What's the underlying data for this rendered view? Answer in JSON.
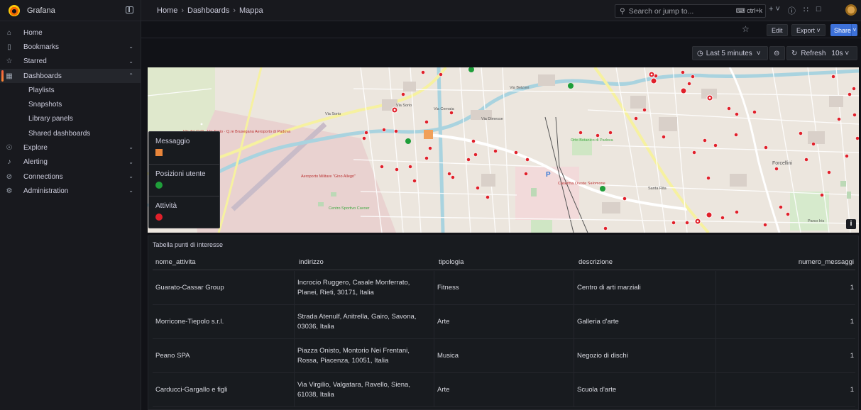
{
  "app": {
    "title": "Grafana"
  },
  "breadcrumb": {
    "home": "Home",
    "dashboards": "Dashboards",
    "current": "Mappa",
    "sep": "›"
  },
  "search": {
    "placeholder": "Search or jump to...",
    "shortcut": "ctrl+k"
  },
  "toolbar": {
    "edit_label": "Edit",
    "export_label": "Export",
    "share_label": "Share"
  },
  "controls": {
    "time_range": "Last 5 minutes",
    "refresh_label": "Refresh",
    "refresh_interval": "10s"
  },
  "sidebar": {
    "items": [
      {
        "label": "Home",
        "icon": "home-icon"
      },
      {
        "label": "Bookmarks",
        "icon": "bookmark-icon"
      },
      {
        "label": "Starred",
        "icon": "star-icon"
      },
      {
        "label": "Dashboards",
        "icon": "apps-icon"
      },
      {
        "label": "Explore",
        "icon": "compass-icon"
      },
      {
        "label": "Alerting",
        "icon": "bell-icon"
      },
      {
        "label": "Connections",
        "icon": "plug-icon"
      },
      {
        "label": "Administration",
        "icon": "cog-icon"
      }
    ],
    "dashboards_sub": [
      "Playlists",
      "Snapshots",
      "Library panels",
      "Shared dashboards"
    ]
  },
  "map": {
    "legend": [
      {
        "label": "Messaggio",
        "color": "#e8853a",
        "shape": "square"
      },
      {
        "label": "Posizioni utente",
        "color": "#1f9e3a",
        "shape": "circle"
      },
      {
        "label": "Attività",
        "color": "#e0202a",
        "shape": "circle"
      }
    ],
    "labels": [
      "Via Sorio",
      "Via Sorio",
      "Via dei Colli · Via Sorio · Q.re Brusegana Aeroporto di Padova",
      "Aeroporto Militare \"Gino Allegri\"",
      "Centro Sportivo Cavoer",
      "Orto Botanico di Padova",
      "Caserma Oreste Salomone",
      "Santa Rita",
      "Forcellini",
      "Parco Iris",
      "Via Cernaia",
      "Via Dimesse",
      "Via Belzoni"
    ],
    "info_label": "i"
  },
  "table": {
    "title": "Tabella punti di interesse",
    "columns": [
      "nome_attivita",
      "indirizzo",
      "tipologia",
      "descrizione",
      "numero_messaggi"
    ],
    "rows": [
      {
        "nome_attivita": "Guarato-Cassar Group",
        "indirizzo_1": "Incrocio Ruggero, Casale Monferrato,",
        "indirizzo_2": "Planei, Rieti, 30171, Italia",
        "tipologia": "Fitness",
        "descrizione": "Centro di arti marziali",
        "numero_messaggi": "1"
      },
      {
        "nome_attivita": "Morricone-Tiepolo s.r.l.",
        "indirizzo_1": "Strada Atenulf, Anitrella, Gairo, Savona,",
        "indirizzo_2": "03036, Italia",
        "tipologia": "Arte",
        "descrizione": "Galleria d'arte",
        "numero_messaggi": "1"
      },
      {
        "nome_attivita": "Peano SPA",
        "indirizzo_1": "Piazza Onisto, Montorio Nei Frentani,",
        "indirizzo_2": "Rossa, Piacenza, 10051, Italia",
        "tipologia": "Musica",
        "descrizione": "Negozio di dischi",
        "numero_messaggi": "1"
      },
      {
        "nome_attivita": "Carducci-Gargallo e figli",
        "indirizzo_1": "Via Virgilio, Valgatara, Ravello, Siena,",
        "indirizzo_2": "61038, Italia",
        "tipologia": "Arte",
        "descrizione": "Scuola d'arte",
        "numero_messaggi": "1"
      }
    ]
  }
}
